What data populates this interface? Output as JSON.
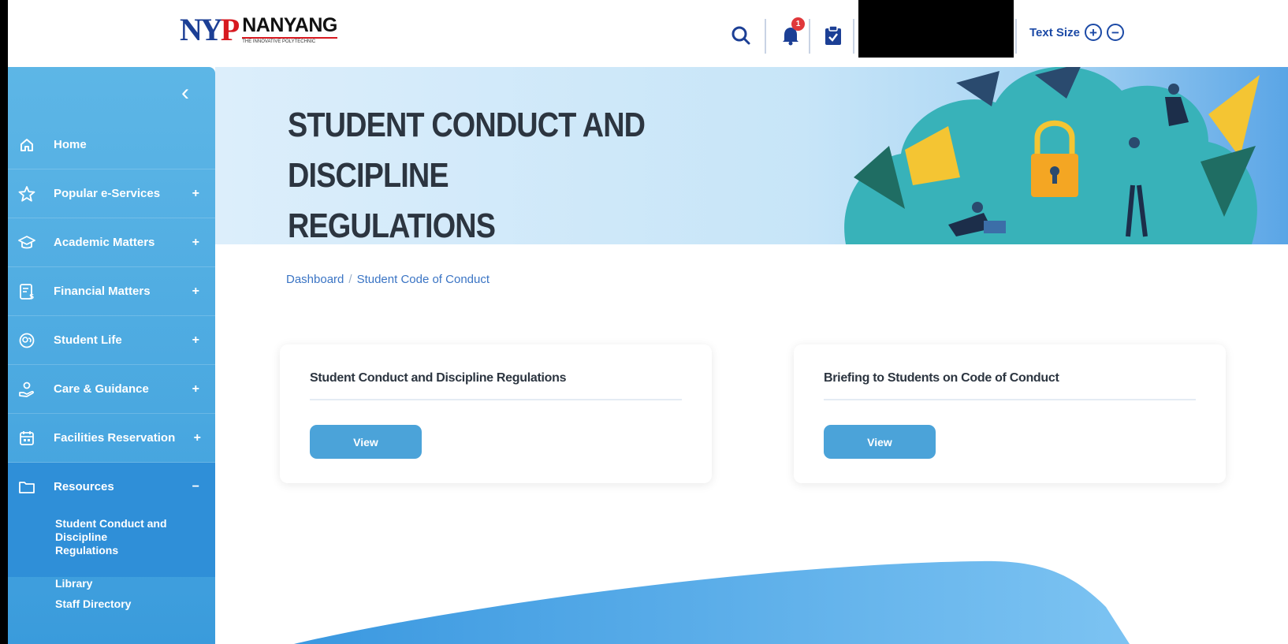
{
  "header": {
    "logo_mark": "NY",
    "logo_mark_p": "P",
    "logo_name": "NANYANG",
    "logo_tagline": "THE INNOVATIVE POLYTECHNIC",
    "notification_count": "1",
    "text_size_label": "Text Size",
    "text_size_increase": "+",
    "text_size_decrease": "−"
  },
  "sidebar": {
    "collapse_label": "‹",
    "items": [
      {
        "label": "Home",
        "toggle": "",
        "icon": "home-icon"
      },
      {
        "label": "Popular e-Services",
        "toggle": "+",
        "icon": "star-icon"
      },
      {
        "label": "Academic Matters",
        "toggle": "+",
        "icon": "graduation-cap-icon"
      },
      {
        "label": "Financial Matters",
        "toggle": "+",
        "icon": "invoice-dollar-icon"
      },
      {
        "label": "Student Life",
        "toggle": "+",
        "icon": "student-life-icon"
      },
      {
        "label": "Care & Guidance",
        "toggle": "+",
        "icon": "care-hand-icon"
      },
      {
        "label": "Facilities Reservation",
        "toggle": "+",
        "icon": "calendar-icon"
      },
      {
        "label": "Resources",
        "toggle": "−",
        "icon": "folder-icon"
      }
    ],
    "sub_items": [
      {
        "label_lines": [
          "Student Conduct and",
          "Discipline",
          "Regulations"
        ]
      },
      {
        "label": "Library"
      },
      {
        "label": "Staff Directory"
      }
    ]
  },
  "banner": {
    "title_line1": "STUDENT CONDUCT AND DISCIPLINE",
    "title_line2": "REGULATIONS"
  },
  "breadcrumb": {
    "items": [
      "Dashboard",
      "Student Code of Conduct"
    ],
    "separator": "/"
  },
  "cards": [
    {
      "title": "Student Conduct and Discipline Regulations",
      "button_label": "View"
    },
    {
      "title": "Briefing to Students on Code of Conduct",
      "button_label": "View"
    }
  ],
  "colors": {
    "sidebar": "#4aa8e0",
    "sidebar_active": "#2f8fd8",
    "button": "#4ba3d9",
    "brand_blue": "#1c3f95",
    "brand_red": "#d71920",
    "badge": "#e0383b"
  }
}
